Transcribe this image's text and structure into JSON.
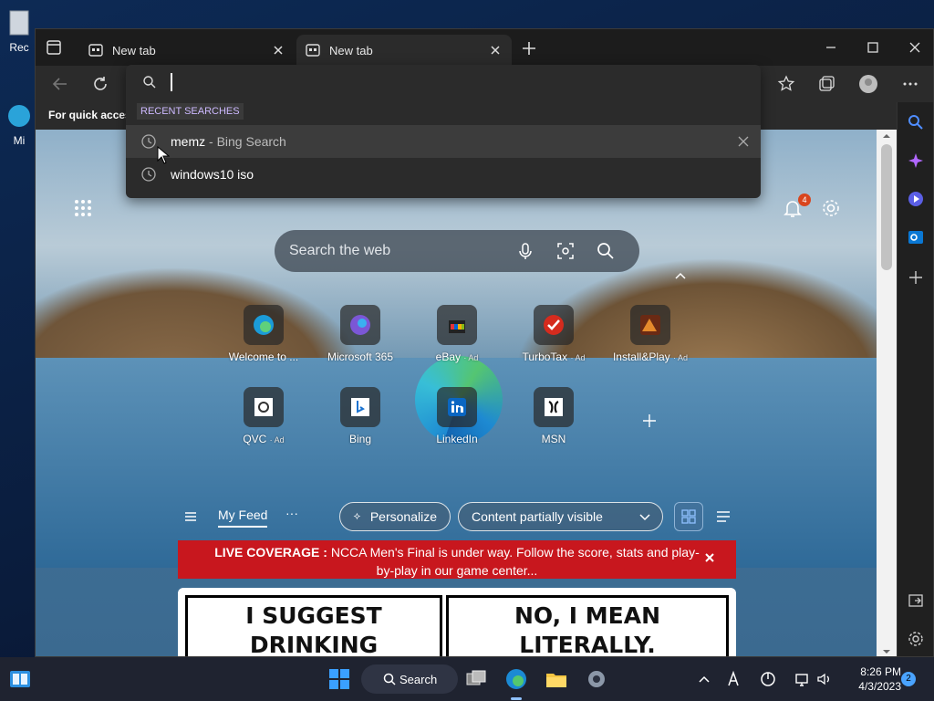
{
  "desktop": {
    "icon1_label": "Rec",
    "icon2_label": "Mi"
  },
  "tabs": [
    {
      "title": "New tab"
    },
    {
      "title": "New tab"
    }
  ],
  "favbar": {
    "text": "For quick access"
  },
  "omnibox": {
    "section_title": "RECENT SEARCHES",
    "rows": [
      {
        "main": "memz",
        "sub": " - Bing Search"
      },
      {
        "main": "windows10 iso",
        "sub": ""
      }
    ]
  },
  "newtab": {
    "notification_count": "4",
    "search_placeholder": "Search the web",
    "tiles": [
      {
        "label": "Welcome to ...",
        "ad": ""
      },
      {
        "label": "Microsoft 365",
        "ad": ""
      },
      {
        "label": "eBay",
        "ad": "· Ad"
      },
      {
        "label": "TurboTax",
        "ad": "· Ad"
      },
      {
        "label": "Install&Play",
        "ad": "· Ad"
      },
      {
        "label": "QVC",
        "ad": "· Ad"
      },
      {
        "label": "Bing",
        "ad": ""
      },
      {
        "label": "LinkedIn",
        "ad": ""
      },
      {
        "label": "MSN",
        "ad": ""
      }
    ],
    "feed": {
      "tab": "My Feed",
      "more": "···",
      "personalize": "Personalize",
      "visibility": "Content partially visible"
    },
    "banner": {
      "bold": "LIVE COVERAGE :",
      "text": " NCCA Men's Final is under way. Follow the score, stats and play-by-play in our game center..."
    },
    "comic": {
      "panel1": "I SUGGEST DRINKING\nA GLASS OF WATER\nBEFORE ORDERING",
      "panel2": "NO, I MEAN LITERALLY.\nMY EYES ARE\nLITERALLY BIGGER"
    }
  },
  "taskbar": {
    "search_label": "Search",
    "time": "8:26 PM",
    "date": "4/3/2023",
    "notifications": "2"
  },
  "colors": {
    "accent": "#cdb9ff",
    "banner": "#c8171e",
    "taskbar": "#1f2330"
  }
}
